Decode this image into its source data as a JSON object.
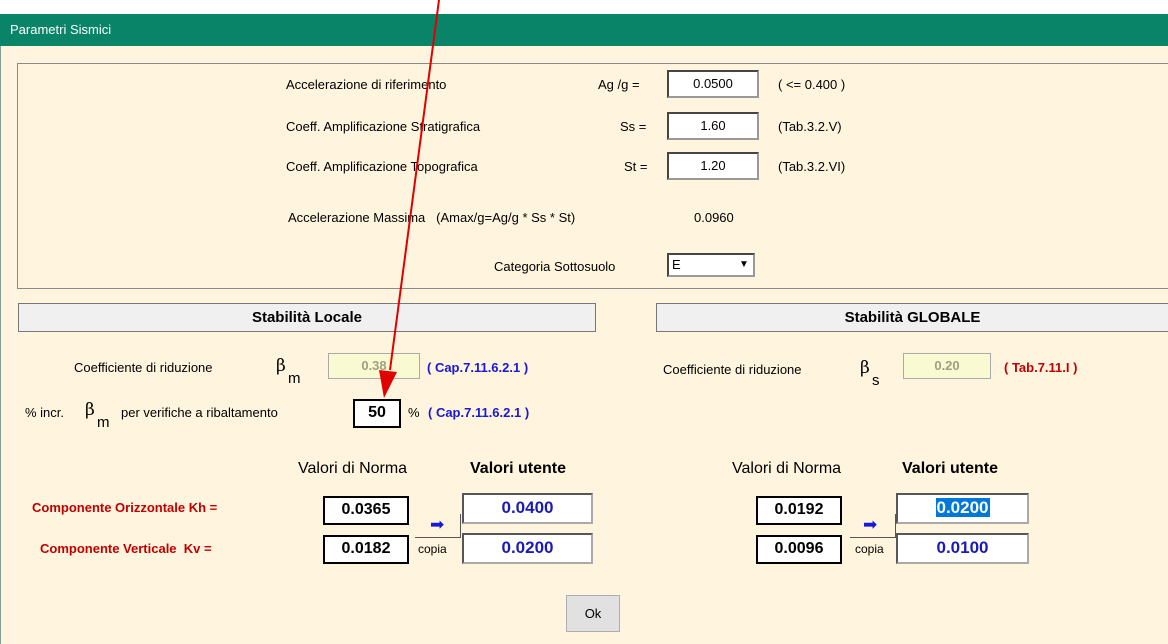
{
  "window": {
    "title": "Parametri Sismici"
  },
  "params": {
    "ag": {
      "label": "Accelerazione di riferimento",
      "symbol": "Ag /g =",
      "value": "0.0500",
      "note": "( <= 0.400 )"
    },
    "ss": {
      "label": "Coeff. Amplificazione Stratigrafica",
      "symbol": "Ss =",
      "value": "1.60",
      "note": "(Tab.3.2.V)"
    },
    "st": {
      "label": "Coeff. Amplificazione Topografica",
      "symbol": "St =",
      "value": "1.20",
      "note": "(Tab.3.2.VI)"
    },
    "amax": {
      "label": "Accelerazione Massima   (Amax/g=Ag/g * Ss * St)",
      "value": "0.0960"
    },
    "soil": {
      "label": "Categoria Sottosuolo",
      "value": "E"
    }
  },
  "local": {
    "header": "Stabilità Locale",
    "coef_label": "Coefficiente di riduzione",
    "beta": "β",
    "beta_sub": "m",
    "beta_value": "0.38",
    "ref": "( Cap.7.11.6.2.1 )",
    "incr_prefix": "% incr.",
    "incr_suffix": "per verifiche a ribaltamento",
    "incr_value": "50",
    "incr_unit": "%",
    "incr_ref": "( Cap.7.11.6.2.1 )",
    "norm_header": "Valori di Norma",
    "user_header": "Valori utente",
    "kh_label": "Componente Orizzontale Kh =",
    "kv_label": "Componente Verticale  Kv =",
    "kh_norm": "0.0365",
    "kv_norm": "0.0182",
    "kh_user": "0.0400",
    "kv_user": "0.0200",
    "copy_label": "copia"
  },
  "global": {
    "header": "Stabilità GLOBALE",
    "coef_label": "Coefficiente di riduzione",
    "beta": "β",
    "beta_sub": "s",
    "beta_value": "0.20",
    "ref": "( Tab.7.11.I )",
    "norm_header": "Valori di Norma",
    "user_header": "Valori utente",
    "kh_norm": "0.0192",
    "kv_norm": "0.0096",
    "kh_user": "0.0200",
    "kv_user": "0.0100",
    "copy_label": "copia"
  },
  "ok_button": "Ok",
  "colors": {
    "titlebar": "#0a8468",
    "background": "#fff4dd",
    "link_blue": "#1818d8",
    "label_red": "#c00000",
    "arrow_red": "#e00000"
  }
}
